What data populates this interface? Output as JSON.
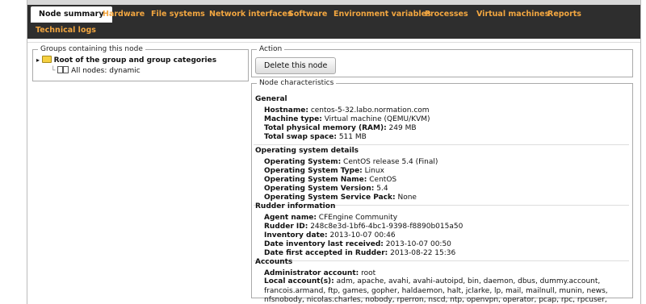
{
  "tabs": [
    {
      "label": "Node summary",
      "active": true
    },
    {
      "label": "Hardware"
    },
    {
      "label": "File systems"
    },
    {
      "label": "Network interfaces"
    },
    {
      "label": "Software"
    },
    {
      "label": "Environment variables"
    },
    {
      "label": "Processes"
    },
    {
      "label": "Virtual machines"
    },
    {
      "label": "Reports"
    },
    {
      "label": "Technical logs"
    }
  ],
  "groups": {
    "legend": "Groups containing this node",
    "root_label": "Root of the group and group categories",
    "child_label": "All nodes: dynamic"
  },
  "action": {
    "legend": "Action",
    "delete_label": "Delete this node"
  },
  "characteristics": {
    "legend": "Node characteristics",
    "general": {
      "title": "General",
      "hostname_label": "Hostname:",
      "hostname": "centos-5-32.labo.normation.com",
      "machine_type_label": "Machine type:",
      "machine_type": "Virtual machine (QEMU/KVM)",
      "memory_label": "Total physical memory (RAM):",
      "memory": "249 MB",
      "swap_label": "Total swap space:",
      "swap": "511 MB"
    },
    "os": {
      "title": "Operating system details",
      "os_label": "Operating System:",
      "os": "CentOS release 5.4 (Final)",
      "type_label": "Operating System Type:",
      "type": "Linux",
      "name_label": "Operating System Name:",
      "name": "CentOS",
      "version_label": "Operating System Version:",
      "version": "5.4",
      "sp_label": "Operating System Service Pack:",
      "sp": "None"
    },
    "rudder": {
      "title": "Rudder information",
      "agent_label": "Agent name:",
      "agent": "CFEngine Community",
      "id_label": "Rudder ID:",
      "id": "248c8e3d-1bf6-4bc1-9398-f8890b015a50",
      "inv_label": "Inventory date:",
      "inv": "2013-10-07 00:46",
      "last_label": "Date inventory last received:",
      "last": "2013-10-07 00:50",
      "first_label": "Date first accepted in Rudder:",
      "first": "2013-08-22 15:36"
    },
    "accounts": {
      "title": "Accounts",
      "admin_label": "Administrator account:",
      "admin": "root",
      "local_label": "Local account(s):",
      "local": "adm, apache, avahi, avahi-autoipd, bin, daemon, dbus, dummy.account, francois.armand, ftp, games, gopher, haldaemon, halt, jclarke, lp, mail, mailnull, munin, news, nfsnobody, nicolas.charles, nobody, rperron, nscd, ntp, openvpn, operator, pcap, rpc, rpcuser, shutdown, smmsp, sshd, sync, uucp, vcsa"
    }
  }
}
